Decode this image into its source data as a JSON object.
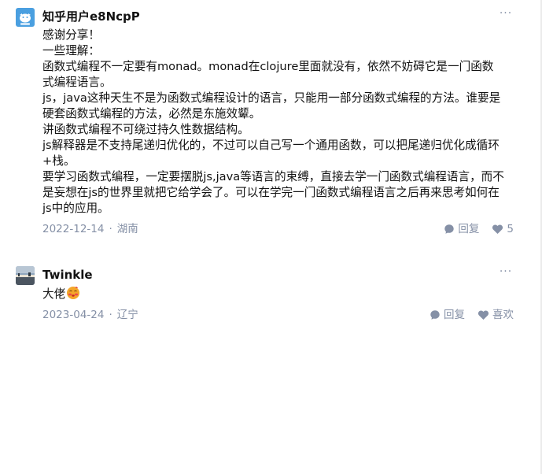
{
  "comments": [
    {
      "author": "知乎用户e8NcpP",
      "lines": [
        "感谢分享！",
        "一些理解：",
        "函数式编程不一定要有monad。monad在clojure里面就没有，依然不妨碍它是一门函数",
        "式编程语言。",
        "js，java这种天生不是为函数式编程设计的语言，只能用一部分函数式编程的方法。谁要是",
        "硬套函数式编程的方法，必然是东施效颦。",
        "讲函数式编程不可绕过持久性数据结构。",
        "js解释器是不支持尾递归优化的，不过可以自己写一个通用函数，可以把尾递归优化成循环",
        "+栈。",
        "要学习函数式编程，一定要摆脱js,java等语言的束缚，直接去学一门函数式编程语言，而不",
        "是妄想在js的世界里就把它给学会了。可以在学完一门函数式编程语言之后再来思考如何在",
        "js中的应用。"
      ],
      "date": "2022-12-14",
      "location": "湖南",
      "reply_label": "回复",
      "like_label": "5",
      "more_label": "···"
    },
    {
      "author": "Twinkle",
      "text": "大佬",
      "emoji": "blushing-face-emoji",
      "date": "2023-04-24",
      "location": "辽宁",
      "reply_label": "回复",
      "like_label": "喜欢",
      "more_label": "···"
    }
  ],
  "separator": "·",
  "colors": {
    "text": "#121212",
    "meta": "#8590a6",
    "avatar1_bg": "#4a9fe0",
    "avatar2_sky": "#8fa6bd"
  }
}
